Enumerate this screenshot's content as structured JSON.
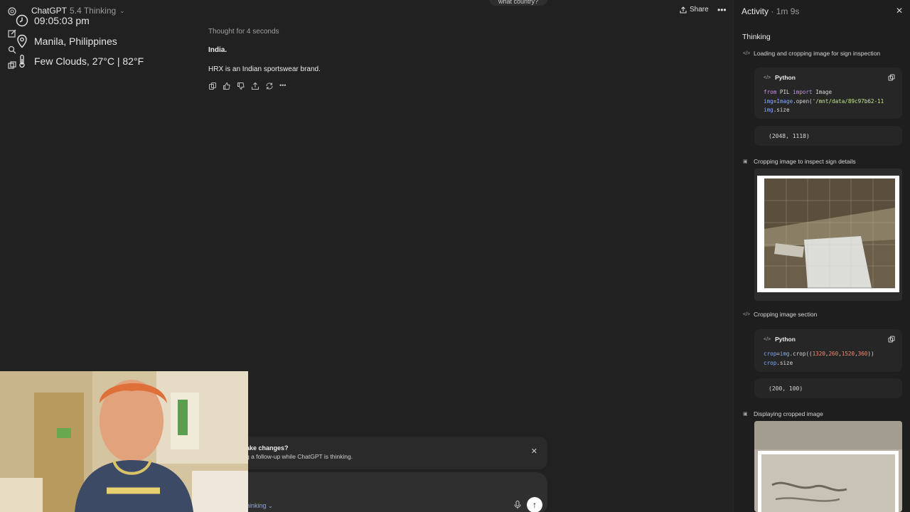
{
  "header": {
    "app_name": "ChatGPT",
    "model_version": "5.4 Thinking",
    "share_label": "Share",
    "top_bubble_text": "what country?"
  },
  "overlay": {
    "time": "09:05:03 pm",
    "location": "Manila, Philippines",
    "weather": "Few Clouds, 27°C | 82°F"
  },
  "chat": {
    "thought_label": "Thought for 4 seconds",
    "answer_bold": "India.",
    "answer_text": "HRX is an Indian sportswear brand."
  },
  "composer": {
    "notice_title": "ake changes?",
    "notice_sub": "g a follow-up while ChatGPT is thinking.",
    "mode_label": "hinking"
  },
  "panel": {
    "title": "Activity",
    "duration": "1m 9s",
    "thinking_label": "Thinking",
    "steps": [
      {
        "label": "Loading and cropping image for sign inspection",
        "icon": "code-icon"
      },
      {
        "label": "Cropping image to inspect sign details",
        "icon": "image-icon"
      },
      {
        "label": "Cropping image section",
        "icon": "code-icon"
      },
      {
        "label": "Displaying cropped image",
        "icon": "image-icon"
      }
    ],
    "code_blocks": [
      {
        "language": "Python",
        "lines": [
          "from PIL import Image",
          "img=Image.open('/mnt/data/89c97b62-11",
          "img.size"
        ],
        "output": "(2048, 1118)"
      },
      {
        "language": "Python",
        "lines": [
          "crop=img.crop((1320,260,1520,360))",
          "crop.size"
        ],
        "output": "(200, 100)"
      }
    ]
  },
  "colors": {
    "background": "#212121",
    "panel": "#1e1e1e",
    "code_box": "#262626",
    "keyword": "#c792ea",
    "string": "#c3e88d",
    "number": "#f78c6c"
  }
}
